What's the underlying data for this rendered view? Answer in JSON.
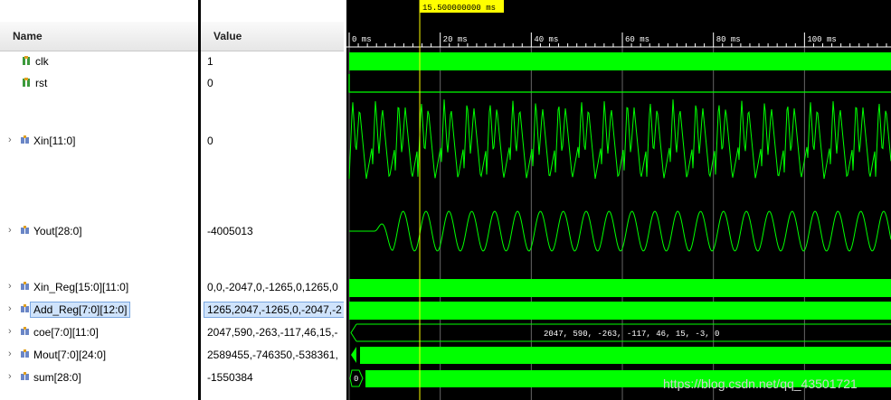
{
  "columns": {
    "name": "Name",
    "value": "Value"
  },
  "signals": [
    {
      "name": "clk",
      "value": "1",
      "kind": "bit",
      "expandable": false
    },
    {
      "name": "rst",
      "value": "0",
      "kind": "bit",
      "expandable": false
    },
    {
      "name": "Xin[11:0]",
      "value": "0",
      "kind": "bus",
      "expandable": true
    },
    {
      "name": "Yout[28:0]",
      "value": "-4005013",
      "kind": "bus",
      "expandable": true
    },
    {
      "name": "Xin_Reg[15:0][11:0]",
      "value": "0,0,-2047,0,-1265,0,1265,0",
      "kind": "array",
      "expandable": true
    },
    {
      "name": "Add_Reg[7:0][12:0]",
      "value": "1265,2047,-1265,0,-2047,-2",
      "kind": "array",
      "expandable": true,
      "selected": true
    },
    {
      "name": "coe[7:0][11:0]",
      "value": "2047,590,-263,-117,46,15,-",
      "kind": "array",
      "expandable": true
    },
    {
      "name": "Mout[7:0][24:0]",
      "value": "2589455,-746350,-538361,",
      "kind": "array",
      "expandable": true
    },
    {
      "name": "sum[28:0]",
      "value": "-1550384",
      "kind": "bus",
      "expandable": true
    }
  ],
  "timeline": {
    "cursor_label": "15.500000000 ms",
    "cursor_time_ms": 15.5,
    "ticks": [
      "0 ms",
      "20 ms",
      "40 ms",
      "60 ms",
      "80 ms",
      "100 ms"
    ],
    "visible_range_ms": [
      0,
      119
    ]
  },
  "bus_values": {
    "coe": "2047, 590, -263, -117, 46, 15, -3, 0",
    "sum_initial": "0"
  },
  "watermark": "https://blog.csdn.net/qq_43501721",
  "colors": {
    "wave": "#00ff00",
    "cursor": "#ffff00",
    "background": "#000000"
  }
}
